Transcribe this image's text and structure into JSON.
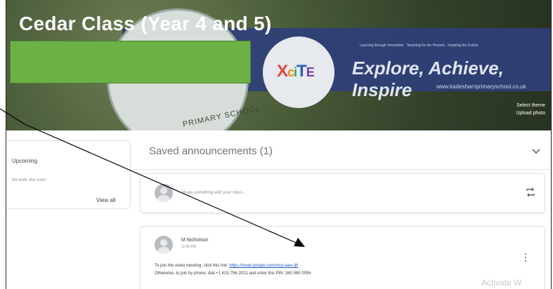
{
  "class": {
    "title": "Cedar Class (Year 4 and 5)",
    "theme_link": "Select theme",
    "upload_link": "Upload photo"
  },
  "banner": {
    "crest_text": "PRIMARY SCHOOL",
    "xcite_letters": [
      "X",
      "c",
      "i",
      "T",
      "E"
    ],
    "tagline": "Learning through Innovation · Teaching for the Present · Inspiring the Future",
    "motto": "Explore, Achieve, Inspire",
    "website": "www.kadesharnprimaryschool.co.uk",
    "redaction_color": "#6cb046"
  },
  "upcoming": {
    "heading": "Upcoming",
    "empty_text": "No work due soon",
    "view_all": "View all"
  },
  "saved_announcements": {
    "label": "Saved announcements (1)",
    "icon": "chevron-down-icon"
  },
  "composer": {
    "placeholder": "Share something with your class..."
  },
  "post": {
    "author": "M Nicholson",
    "time": "11:05 AM",
    "line1_prefix": "To join the video meeting, click this link: ",
    "line1_link": "https://meet.google.com/mcy-iaeo-ijh",
    "line2": "Otherwise, to join by phone, dial +1 415-756-2021 and enter this PIN: 340 560 009#"
  },
  "watermark": "Activate W",
  "colors": {
    "banner_blue": "#2f3f7a",
    "link": "#1a58c9",
    "annotation_line": "#000000"
  }
}
